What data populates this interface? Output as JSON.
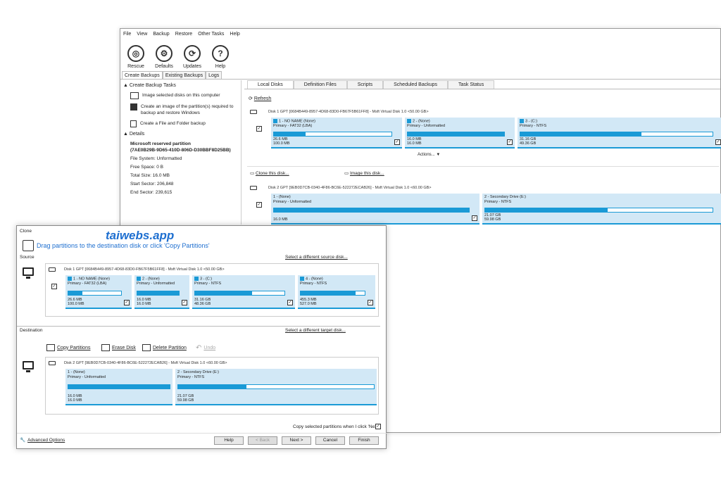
{
  "menu": [
    "File",
    "View",
    "Backup",
    "Restore",
    "Other Tasks",
    "Help"
  ],
  "toolbar": [
    {
      "label": "Rescue",
      "icon": "lifebuoy-icon",
      "glyph": "◎"
    },
    {
      "label": "Defaults",
      "icon": "gear-icon",
      "glyph": "⚙"
    },
    {
      "label": "Updates",
      "icon": "refresh-icon",
      "glyph": "⟳"
    },
    {
      "label": "Help",
      "icon": "help-icon",
      "glyph": "?"
    }
  ],
  "maintabs": [
    "Create Backups",
    "Existing Backups",
    "Logs"
  ],
  "left": {
    "tasks_head": "Create Backup Tasks",
    "tasks": [
      "Image selected disks on this computer",
      "Create an image of the partition(s) required to backup and restore Windows",
      "Create a File and Folder backup"
    ],
    "details_head": "Details",
    "details_name": "Microsoft reserved partition",
    "details_guid": "(7AE0B29B-9D65-410D-806D-D30BBF8D25BB)",
    "fields": [
      "File System: Unformatted",
      "Free Space:  0 B",
      "Total Size:  16.0 MB",
      "Start Sector:  206,848",
      "End Sector:  239,615"
    ]
  },
  "righttabs": [
    "Local Disks",
    "Definition Files",
    "Scripts",
    "Scheduled Backups",
    "Task Status"
  ],
  "refresh": "Refresh",
  "bg_disk1": {
    "head": "Disk 1 GPT [0684B449-8957-4D68-83D0-FB67F5B61FF8] - Msft     Virtual Disk     1.0  <50.00 GB>",
    "parts": [
      {
        "name": "1 - NO NAME (None)",
        "type": "Primary - FAT32 (LBA)",
        "s1": "26.6 MB",
        "s2": "100.0 MB",
        "fill": 0.27
      },
      {
        "name": "2 -  (None)",
        "type": "Primary - Unformatted",
        "s1": "16.0 MB",
        "s2": "16.0 MB",
        "fill": 1
      },
      {
        "name": "3 -  (C:)",
        "type": "Primary - NTFS",
        "s1": "31.16 GB",
        "s2": "49.36 GB",
        "fill": 0.63
      }
    ],
    "actions": "Actions... ▼",
    "clone": "Clone this disk...",
    "image": "Image this disk..."
  },
  "bg_disk2": {
    "head": "Disk 2 GPT [9EB0D7CB-0340-4F86-BC6E-522272ECAB26] - Msft     Virtual Disk     1.0  <60.00 GB>",
    "parts": [
      {
        "name": "1 -  (None)",
        "type": "Primary - Unformatted",
        "s1": "16.0 MB",
        "s2": "",
        "fill": 1
      },
      {
        "name": "2 - Secondary Drive (E:)",
        "type": "Primary - NTFS",
        "s1": "21.07 GB",
        "s2": "59.98 GB",
        "fill": 0.35
      }
    ]
  },
  "clone": {
    "title": "Clone",
    "watermark": "taiwebs.app",
    "instruction": "Drag partitions to the destination disk or click 'Copy Partitions'",
    "source": "Source",
    "select_source": "Select a different source disk...",
    "src_head": "Disk 1 GPT [0684B449-8957-4D68-83D0-FB67F5B61FF8] - Msft     Virtual Disk     1.0  <50.00 GB>",
    "src_parts": [
      {
        "name": "1 - NO NAME (None)",
        "type": "Primary - FAT32 (LBA)",
        "s1": "26.6 MB",
        "s2": "100.0 MB",
        "fill": 0.27
      },
      {
        "name": "2 -  (None)",
        "type": "Primary - Unformatted",
        "s1": "16.0 MB",
        "s2": "16.0 MB",
        "fill": 1
      },
      {
        "name": "3 -  (C:)",
        "type": "Primary - NTFS",
        "s1": "31.16 GB",
        "s2": "48.36 GB",
        "fill": 0.64
      },
      {
        "name": "4 -  (None)",
        "type": "Primary - NTFS",
        "s1": "455.3 MB",
        "s2": "527.0 MB",
        "fill": 0.86
      }
    ],
    "destination": "Destination",
    "select_target": "Select a different target disk...",
    "actions": [
      "Copy Partitions",
      "Erase Disk",
      "Delete Partition",
      "Undo"
    ],
    "dst_head": "Disk 2 GPT [9EB0D7CB-0340-4F86-BC6E-522272ECAB26] - Msft     Virtual Disk     1.0  <60.00 GB>",
    "dst_parts": [
      {
        "name": "1 -  (None)",
        "type": "Primary - Unformatted",
        "s1": "16.0 MB",
        "s2": "16.0 MB",
        "fill": 1
      },
      {
        "name": "2 - Secondary Drive (E:)",
        "type": "Primary - NTFS",
        "s1": "21.07 GB",
        "s2": "59.98 GB",
        "fill": 0.35
      }
    ],
    "copy_opt": "Copy selected partitions when I click 'Next'",
    "advanced": "Advanced Options",
    "buttons": [
      "Help",
      "< Back",
      "Next >",
      "Cancel",
      "Finish"
    ]
  },
  "colors": {
    "accent": "#1a9ad6",
    "partition_bg": "#d2e8f6",
    "watermark": "#1e6fd0"
  }
}
